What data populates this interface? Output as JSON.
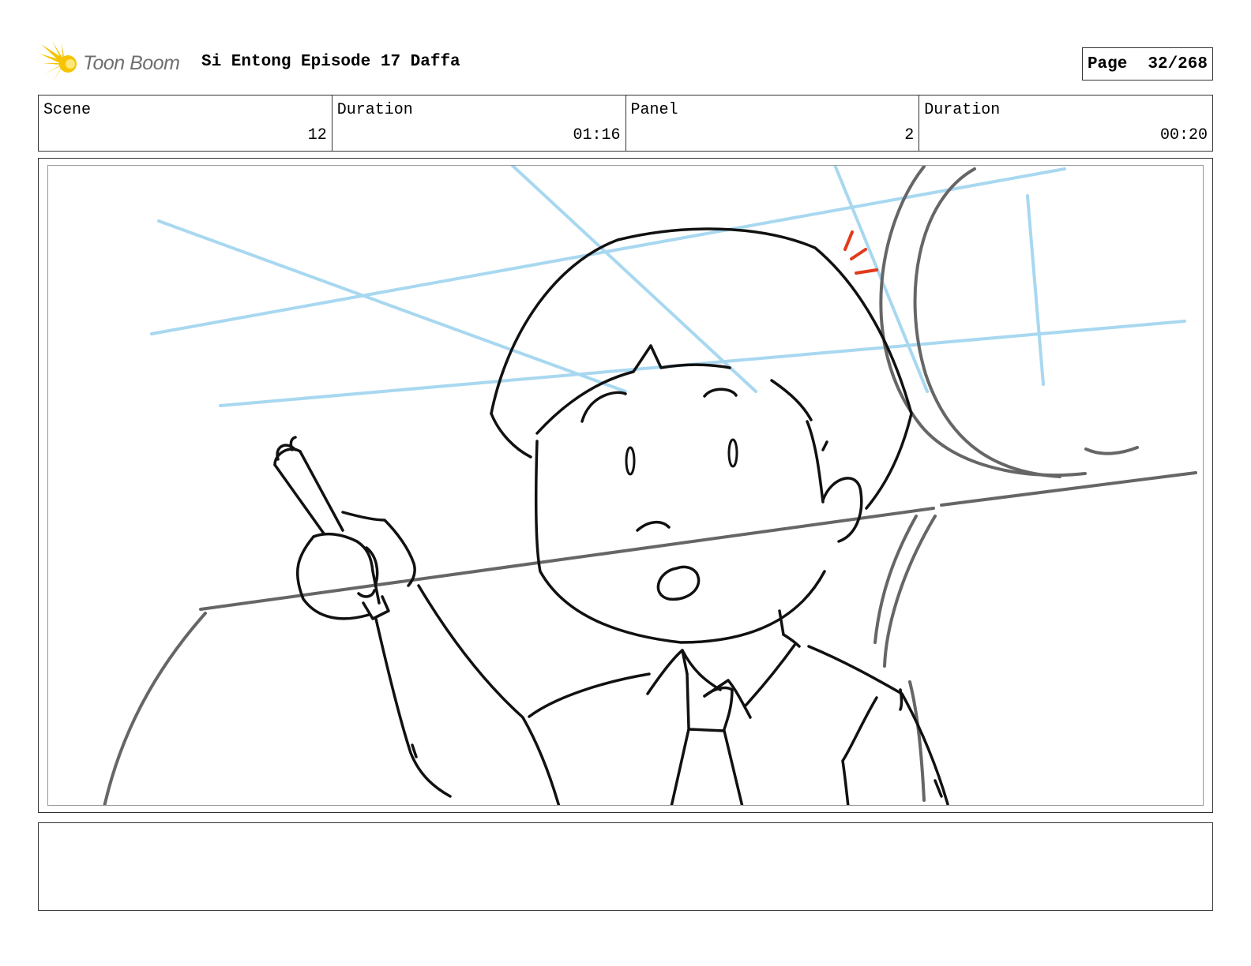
{
  "header": {
    "logo_text": "Toon Boom",
    "title": "Si Entong Episode 17 Daffa",
    "page_label": "Page",
    "page_value": "32/268"
  },
  "info": {
    "scene_label": "Scene",
    "scene_value": "12",
    "scene_duration_label": "Duration",
    "scene_duration_value": "01:16",
    "panel_label": "Panel",
    "panel_value": "2",
    "panel_duration_label": "Duration",
    "panel_duration_value": "00:20"
  },
  "notes": {
    "text": ""
  },
  "colors": {
    "logo_yellow": "#f6c400",
    "guide_blue": "#a8d8f0",
    "accent_red": "#e23a1a",
    "ink": "#111111",
    "pencil_gray": "#666666"
  },
  "icons": {
    "logo": "toon-boom-logo-icon"
  }
}
